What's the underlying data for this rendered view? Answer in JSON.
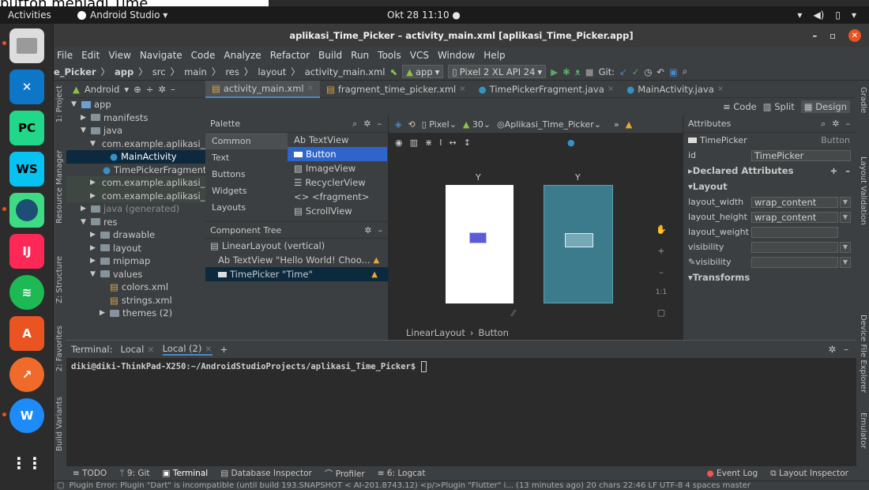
{
  "caption": "button menjadi Time",
  "topbar": {
    "activities": "Activities",
    "app_name": "Android Studio ▾",
    "clock": "Okt 28 11:10 ●"
  },
  "window": {
    "title": "aplikasi_Time_Picker – activity_main.xml [aplikasi_Time_Picker.app]"
  },
  "menu": [
    "File",
    "Edit",
    "View",
    "Navigate",
    "Code",
    "Analyze",
    "Refactor",
    "Build",
    "Run",
    "Tools",
    "VCS",
    "Window",
    "Help"
  ],
  "navbar": {
    "crumbs": [
      "e_Picker",
      "app",
      "src",
      "main",
      "res",
      "layout",
      "activity_main.xml"
    ],
    "run_config": "app",
    "device": "Pixel 2 XL API 24",
    "git_label": "Git:"
  },
  "editor_tabs": [
    {
      "label": "activity_main.xml",
      "active": true
    },
    {
      "label": "fragment_time_picker.xml",
      "active": false
    },
    {
      "label": "TimePickerFragment.java",
      "active": false
    },
    {
      "label": "MainActivity.java",
      "active": false
    }
  ],
  "left_strip": {
    "project": "1: Project",
    "resource": "Resource Manager",
    "structure": "Z: Structure",
    "favorites": "2: Favorites",
    "variants": "Build Variants"
  },
  "right_strip": {
    "gradle": "Gradle",
    "layout_validation": "Layout Validation",
    "device_explorer": "Device File Explorer",
    "emulator": "Emulator"
  },
  "project": {
    "dropdown": "Android",
    "tree": [
      {
        "label": "app",
        "indent": 0,
        "kind": "folder-blue"
      },
      {
        "label": "manifests",
        "indent": 1,
        "kind": "folder"
      },
      {
        "label": "java",
        "indent": 1,
        "kind": "folder"
      },
      {
        "label": "com.example.aplikasi_time_picker",
        "indent": 2,
        "kind": "folder"
      },
      {
        "label": "MainActivity",
        "indent": 3,
        "kind": "class",
        "selected": true
      },
      {
        "label": "TimePickerFragment",
        "indent": 3,
        "kind": "class"
      },
      {
        "label": "com.example.aplikasi_time_picker",
        "indent": 2,
        "kind": "folder",
        "highlight": true
      },
      {
        "label": "com.example.aplikasi_time_picker",
        "indent": 2,
        "kind": "folder",
        "highlight": true
      },
      {
        "label": "java (generated)",
        "indent": 1,
        "kind": "folder"
      },
      {
        "label": "res",
        "indent": 1,
        "kind": "folder"
      },
      {
        "label": "drawable",
        "indent": 2,
        "kind": "folder"
      },
      {
        "label": "layout",
        "indent": 2,
        "kind": "folder"
      },
      {
        "label": "mipmap",
        "indent": 2,
        "kind": "folder"
      },
      {
        "label": "values",
        "indent": 2,
        "kind": "folder"
      },
      {
        "label": "colors.xml",
        "indent": 3,
        "kind": "xml"
      },
      {
        "label": "strings.xml",
        "indent": 3,
        "kind": "xml"
      },
      {
        "label": "themes (2)",
        "indent": 3,
        "kind": "folder"
      }
    ]
  },
  "design_toolbar": {
    "code": "Code",
    "split": "Split",
    "design": "Design"
  },
  "palette": {
    "title": "Palette",
    "categories": [
      "Common",
      "Text",
      "Buttons",
      "Widgets",
      "Layouts"
    ],
    "items": [
      "Ab TextView",
      "Button",
      "ImageView",
      "RecyclerView",
      "<> <fragment>",
      "ScrollView"
    ]
  },
  "component_tree": {
    "title": "Component Tree",
    "rows": [
      "LinearLayout (vertical)",
      "Ab TextView \"Hello World! Choo...",
      "TimePicker \"Time\""
    ]
  },
  "canvas_bar": {
    "device": "Pixel",
    "api": "30",
    "theme": "Aplikasi_Time_Picker"
  },
  "breadcrumb": [
    "LinearLayout",
    "Button"
  ],
  "attributes": {
    "title": "Attributes",
    "component": "TimePicker",
    "component_type": "Button",
    "id_label": "id",
    "id_value": "TimePicker",
    "declared": "Declared Attributes",
    "layout": "Layout",
    "rows": [
      {
        "k": "layout_width",
        "v": "wrap_content"
      },
      {
        "k": "layout_height",
        "v": "wrap_content"
      },
      {
        "k": "layout_weight",
        "v": ""
      },
      {
        "k": "visibility",
        "v": ""
      },
      {
        "k": "visibility",
        "v": ""
      }
    ],
    "transforms": "Transforms"
  },
  "terminal": {
    "label": "Terminal:",
    "tabs": [
      "Local",
      "Local (2)"
    ],
    "prompt": "diki@diki-ThinkPad-X250:~/AndroidStudioProjects/aplikasi_Time_Picker$"
  },
  "toolwindows": [
    "TODO",
    "9: Git",
    "Terminal",
    "Database Inspector",
    "Profiler",
    "6: Logcat",
    "Event Log",
    "Layout Inspector"
  ],
  "statusbar": "Plugin Error: Plugin \"Dart\" is incompatible (until build 193.SNAPSHOT < AI-201.8743.12) <p/>Plugin \"Flutter\" i... (13 minutes ago)   20 chars   22:46   LF   UTF-8   4 spaces   master",
  "colors": {
    "accent": "#4a88c7",
    "selection": "#2f65ca",
    "ubuntu_orange": "#e95420"
  }
}
